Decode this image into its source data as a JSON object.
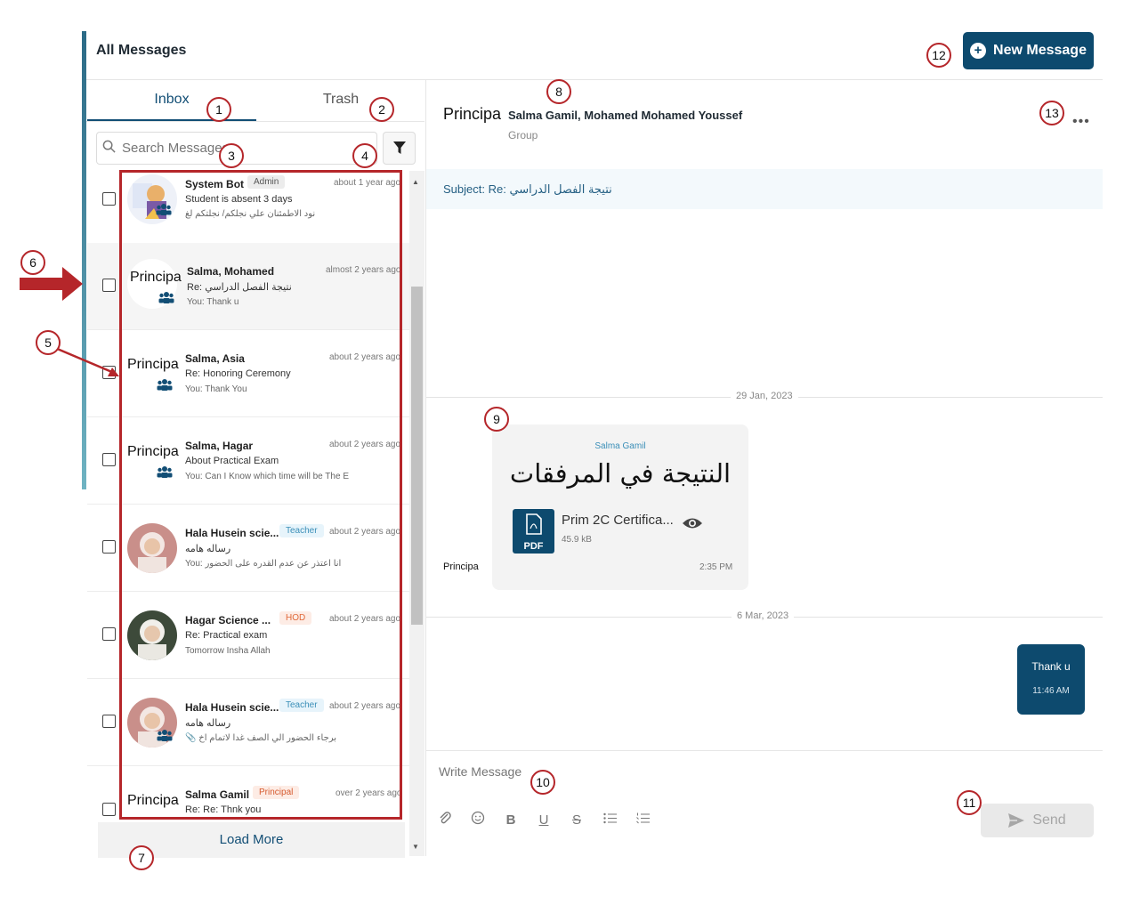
{
  "page": {
    "title": "All Messages",
    "new_message_label": "New Message"
  },
  "tabs": {
    "inbox": "Inbox",
    "trash": "Trash"
  },
  "search": {
    "placeholder": "Search Messages"
  },
  "logo_text": "Principa",
  "inbox_items": [
    {
      "name": "System Bot",
      "badge": "Admin",
      "badge_style": "admin",
      "time": "about 1 year ago",
      "subject": "Student is absent 3 days",
      "preview": "نود الاطمئنان علي نجلكم/ نجلتكم لغ"
    },
    {
      "name": "Salma, Mohamed",
      "badge": "",
      "time": "almost 2 years ago",
      "subject": "Re: نتيجة الفصل الدراسي",
      "preview": "You: Thank u"
    },
    {
      "name": "Salma, Asia",
      "badge": "",
      "time": "about 2 years ago",
      "subject": "Re: Honoring Ceremony",
      "preview": "You: Thank You"
    },
    {
      "name": "Salma, Hagar",
      "badge": "",
      "time": "about 2 years ago",
      "subject": "About Practical Exam",
      "preview": "You: Can I Know which time will be The E"
    },
    {
      "name": "Hala Husein scie...",
      "badge": "Teacher",
      "badge_style": "teacher",
      "time": "about 2 years ago",
      "subject": "رساله هامه",
      "preview": "You: انا اعتذر عن عدم القدره على الحضور"
    },
    {
      "name": "Hagar Science ...",
      "badge": "HOD",
      "badge_style": "hod",
      "time": "about 2 years ago",
      "subject": "Re: Practical exam",
      "preview": "Tomorrow Insha Allah"
    },
    {
      "name": "Hala Husein scie...",
      "badge": "Teacher",
      "badge_style": "teacher",
      "time": "about 2 years ago",
      "subject": "رساله هامه",
      "preview": "برجاء الحضور الي الصف غدا لاتمام اخ"
    },
    {
      "name": "Salma Gamil",
      "badge": "Principal",
      "badge_style": "principal",
      "time": "over 2 years ago",
      "subject": "Re: Re: Thnk you",
      "preview": ""
    }
  ],
  "load_more_label": "Load More",
  "conversation": {
    "participants": "Salma Gamil, Mohamed Mohamed Youssef",
    "type": "Group",
    "subject": "Subject: Re: نتيجة الفصل الدراسي",
    "date_1": "29 Jan, 2023",
    "message_1": {
      "sender": "Salma Gamil",
      "body": "النتيجة في المرفقات",
      "attachment_name": "Prim 2C Certifica...",
      "attachment_size": "45.9 kB",
      "attachment_type": "PDF",
      "time": "2:35 PM"
    },
    "date_2": "6 Mar, 2023",
    "message_2": {
      "body": "Thank u",
      "time": "11:46 AM"
    }
  },
  "compose": {
    "placeholder": "Write Message",
    "send_label": "Send"
  },
  "callouts": [
    "1",
    "2",
    "3",
    "4",
    "5",
    "6",
    "7",
    "8",
    "9",
    "10",
    "11",
    "12",
    "13"
  ],
  "colors": {
    "primary": "#0d4a6e",
    "annotation_red": "#b5262a",
    "teacher_badge": "#3b8fb8",
    "hod_badge": "#e06a3a"
  },
  "icons": [
    "search-icon",
    "filter-icon",
    "group-icon",
    "pdf-icon",
    "eye-icon",
    "attach-icon",
    "emoji-icon",
    "bold-icon",
    "underline-icon",
    "strike-icon",
    "bullet-list-icon",
    "number-list-icon",
    "send-icon",
    "more-icon",
    "plus-icon"
  ]
}
